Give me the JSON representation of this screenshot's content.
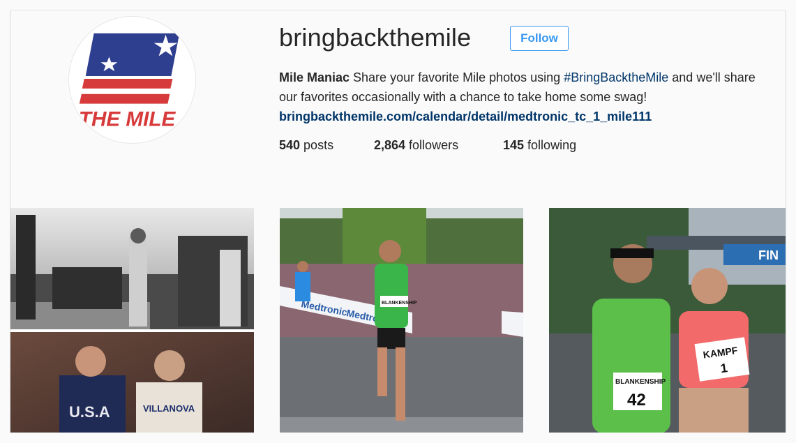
{
  "profile": {
    "username": "bringbackthemile",
    "follow_label": "Follow",
    "logo_text": "THE MILE",
    "bio": {
      "name": "Mile Maniac",
      "text_1": " Share your favorite Mile photos using ",
      "hashtag": "#BringBacktheMile",
      "text_2": " and we'll share our favorites occasionally with a chance to take home some swag!",
      "link": "bringbackthemile.com/calendar/detail/medtronic_tc_1_mile111"
    },
    "stats": {
      "posts_count": "540",
      "posts_label": " posts",
      "followers_count": "2,864",
      "followers_label": " followers",
      "following_count": "145",
      "following_label": " following"
    }
  },
  "posts": [
    {
      "top_caption": "",
      "bottom_jersey_1": "U.S.A",
      "bottom_jersey_2": "VILLANOVA"
    },
    {
      "banner_text": "Medtronic",
      "bib_name": "BLANKENSHIP"
    },
    {
      "bib_1_name": "BLANKENSHIP",
      "bib_1_number": "42",
      "bib_2_name": "KAMPF",
      "bib_2_number": "1",
      "sign_text": "FIN"
    }
  ],
  "colors": {
    "accent": "#3897f0",
    "link": "#003569",
    "logo_blue": "#2f3f8f",
    "logo_red": "#d63a3a"
  }
}
